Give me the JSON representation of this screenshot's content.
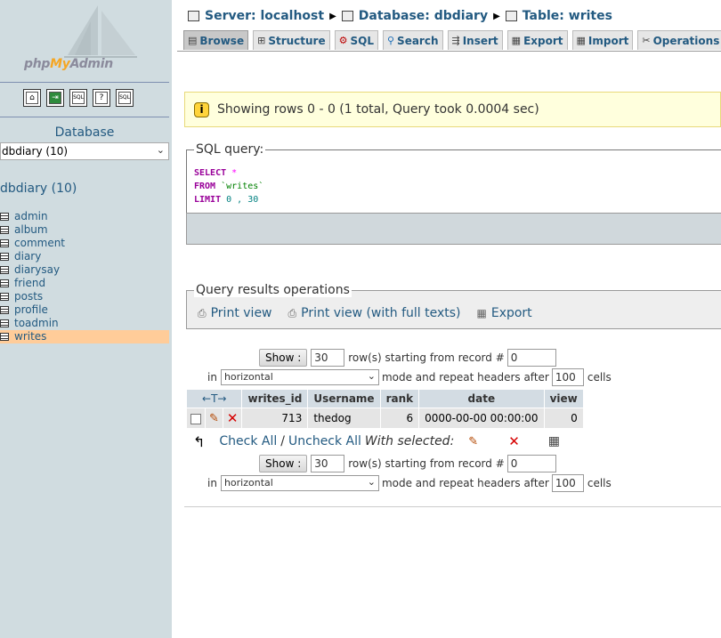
{
  "nav": {
    "logo": {
      "part1": "php",
      "part2": "My",
      "part3": "Admin"
    },
    "icons": [
      "home-icon",
      "exit-icon",
      "sql-icon",
      "docs-icon",
      "sql-docs-icon"
    ],
    "database_label": "Database",
    "database_select": "dbdiary (10)",
    "db_title": "dbdiary (10)",
    "tables": [
      "admin",
      "album",
      "comment",
      "diary",
      "diarysay",
      "friend",
      "posts",
      "profile",
      "toadmin",
      "writes"
    ],
    "active_table": "writes"
  },
  "breadcrumb": {
    "server": "Server: localhost",
    "database": "Database: dbdiary",
    "table": "Table: writes"
  },
  "tabs": [
    {
      "label": "Browse",
      "icon": "browse-icon",
      "active": true
    },
    {
      "label": "Structure",
      "icon": "structure-icon",
      "active": false
    },
    {
      "label": "SQL",
      "icon": "sql-icon",
      "active": false
    },
    {
      "label": "Search",
      "icon": "search-icon",
      "active": false
    },
    {
      "label": "Insert",
      "icon": "insert-icon",
      "active": false
    },
    {
      "label": "Export",
      "icon": "export-icon",
      "active": false
    },
    {
      "label": "Import",
      "icon": "import-icon",
      "active": false
    },
    {
      "label": "Operations",
      "icon": "operations-icon",
      "active": false
    }
  ],
  "notice": "Showing rows 0 - 0 (1 total, Query took 0.0004 sec)",
  "sql": {
    "legend": "SQL query:",
    "select_kw": "SELECT",
    "star": "*",
    "from_kw": "FROM",
    "table": "`writes`",
    "limit_kw": "LIMIT",
    "limit_val": "0 , 30"
  },
  "query_ops": {
    "legend": "Query results operations",
    "print_view": "Print view",
    "print_view_full": "Print view (with full texts)",
    "export": "Export"
  },
  "navigation": {
    "show_label": "Show :",
    "rows_value": "30",
    "rows_text": "row(s) starting from record #",
    "start_value": "0",
    "in_label": "in",
    "mode_value": "horizontal",
    "mode_text": "mode and repeat headers after",
    "headers_value": "100",
    "cells_label": "cells"
  },
  "table": {
    "sort_header": "←T→",
    "columns": [
      "writes_id",
      "Username",
      "rank",
      "date",
      "view"
    ],
    "rows": [
      {
        "writes_id": "713",
        "Username": "thedog",
        "rank": "6",
        "date": "0000-00-00 00:00:00",
        "view": "0"
      }
    ]
  },
  "with_selected": {
    "check_all": "Check All",
    "slash": "/",
    "uncheck_all": "Uncheck All",
    "label": "With selected:"
  }
}
